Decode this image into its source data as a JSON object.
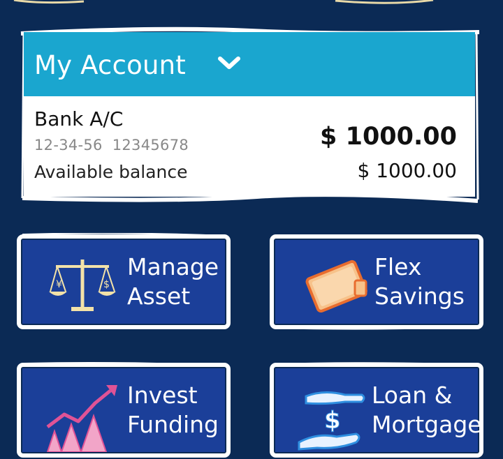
{
  "account": {
    "header_title": "My Account",
    "name": "Bank A/C",
    "sort_code": "12-34-56",
    "account_number": "12345678",
    "balance": "$ 1000.00",
    "available_label": "Available balance",
    "available_value": "$ 1000.00"
  },
  "tiles": [
    {
      "label": "Manage\nAsset",
      "icon": "scales-icon"
    },
    {
      "label": "Flex\nSavings",
      "icon": "wallet-icon"
    },
    {
      "label": "Invest\nFunding",
      "icon": "growth-chart-icon"
    },
    {
      "label": "Loan &\nMortgage",
      "icon": "hand-dollar-icon"
    }
  ],
  "colors": {
    "background": "#0b2a55",
    "header": "#1aa6cf",
    "tile": "#1b3f99"
  }
}
